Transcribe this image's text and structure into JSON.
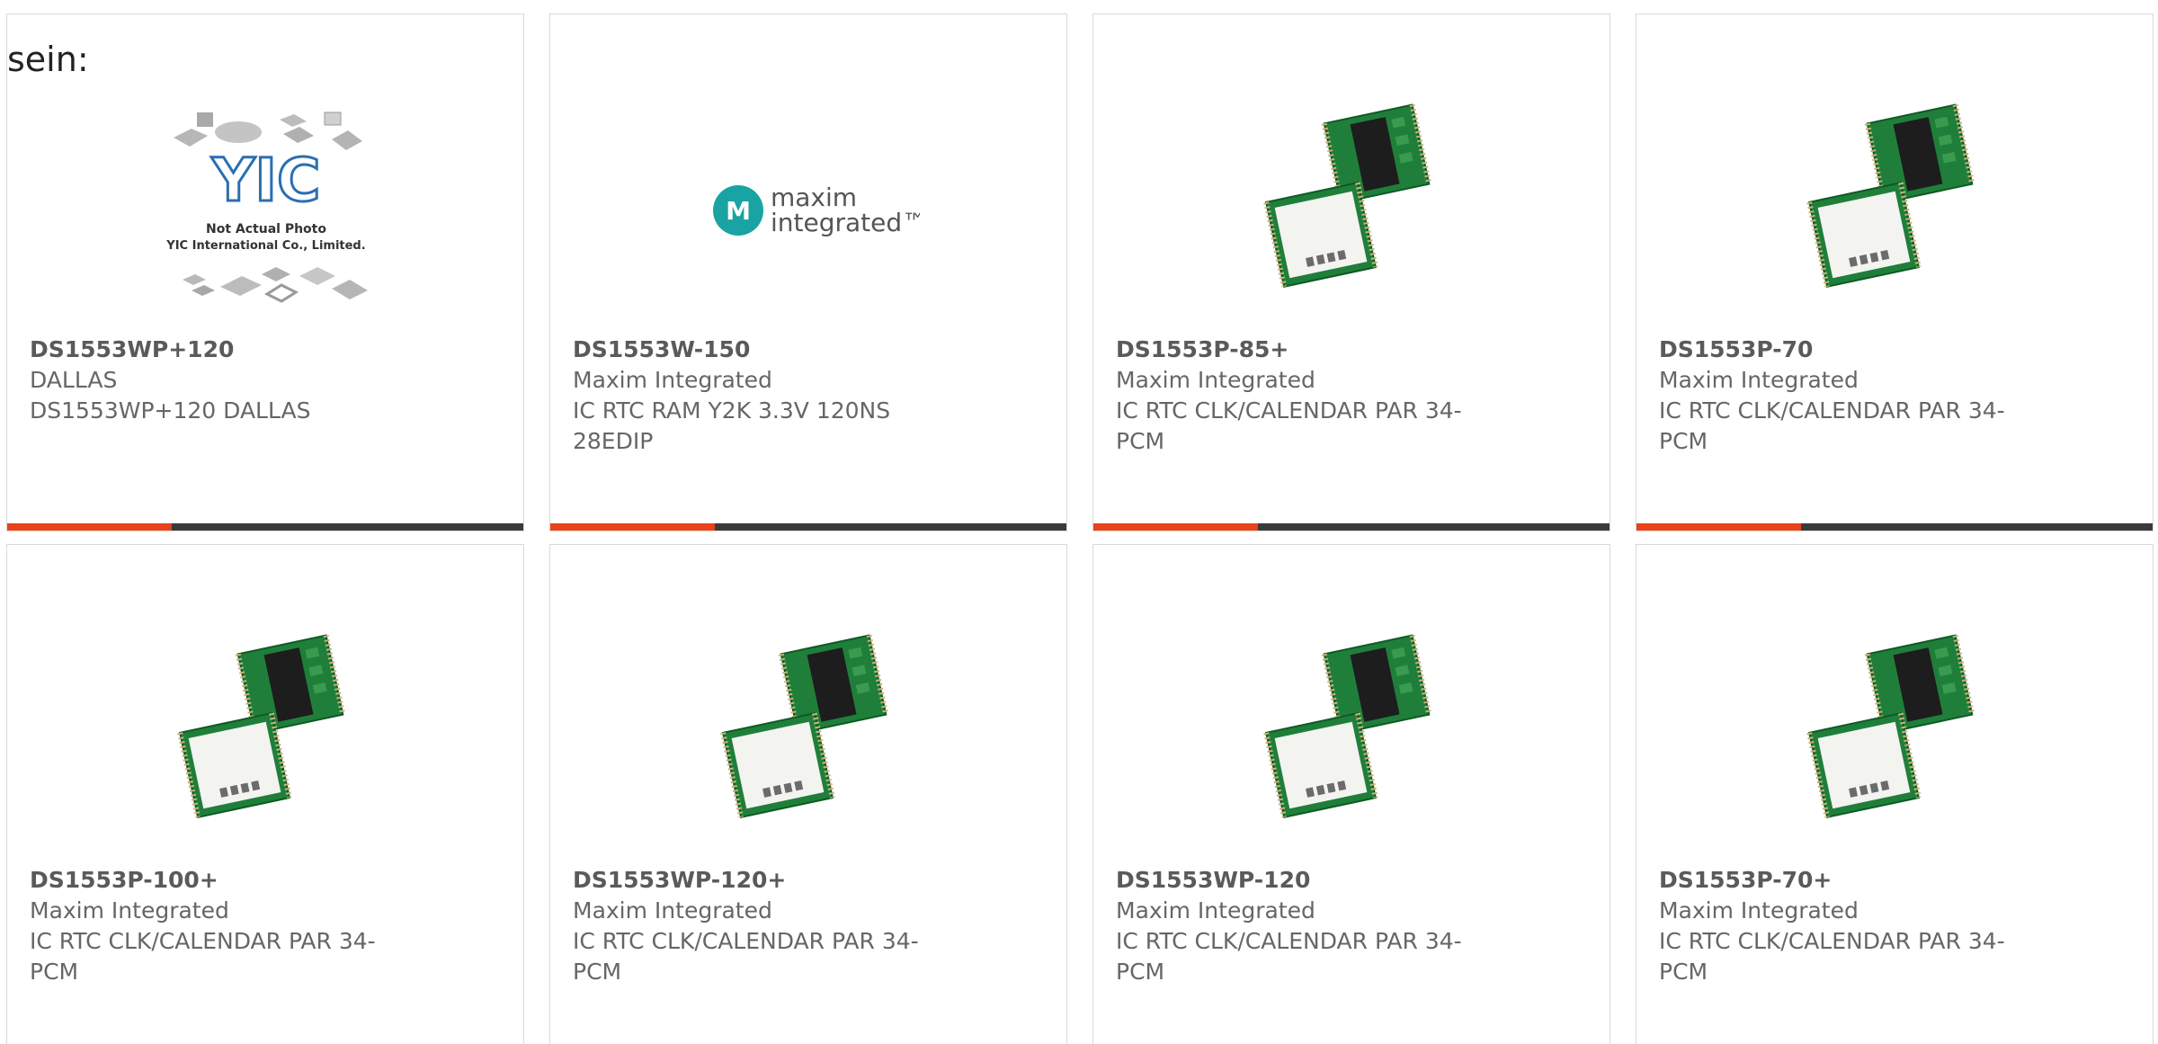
{
  "intro_text": "sein:",
  "colors": {
    "accent": "#e8421a",
    "bar": "#3a3a3a",
    "text": "#666666",
    "border": "#d9d9d9",
    "maxim_teal": "#1aa3a3"
  },
  "products": [
    {
      "part_number": "DS1553WP+120",
      "manufacturer": "DALLAS",
      "description": "DS1553WP+120 DALLAS",
      "image": "not-actual-photo-placeholder",
      "image_text_line1": "Not Actual Photo",
      "image_text_line2": "YIC International Co., Limited.",
      "image_logo": "YIC"
    },
    {
      "part_number": "DS1553W-150",
      "manufacturer": "Maxim Integrated",
      "description": "IC RTC RAM Y2K 3.3V 120NS 28EDIP",
      "image": "maxim-integrated-logo",
      "logo_text_line1": "maxim",
      "logo_text_line2": "integrated™"
    },
    {
      "part_number": "DS1553P-85+",
      "manufacturer": "Maxim Integrated",
      "description": "IC RTC CLK/CALENDAR PAR 34-PCM",
      "image": "pcm-module-photo"
    },
    {
      "part_number": "DS1553P-70",
      "manufacturer": "Maxim Integrated",
      "description": "IC RTC CLK/CALENDAR PAR 34-PCM",
      "image": "pcm-module-photo"
    },
    {
      "part_number": "DS1553P-100+",
      "manufacturer": "Maxim Integrated",
      "description": "IC RTC CLK/CALENDAR PAR 34-PCM",
      "image": "pcm-module-photo"
    },
    {
      "part_number": "DS1553WP-120+",
      "manufacturer": "Maxim Integrated",
      "description": "IC RTC CLK/CALENDAR PAR 34-PCM",
      "image": "pcm-module-photo"
    },
    {
      "part_number": "DS1553WP-120",
      "manufacturer": "Maxim Integrated",
      "description": "IC RTC CLK/CALENDAR PAR 34-PCM",
      "image": "pcm-module-photo"
    },
    {
      "part_number": "DS1553P-70+",
      "manufacturer": "Maxim Integrated",
      "description": "IC RTC CLK/CALENDAR PAR 34-PCM",
      "image": "pcm-module-photo"
    }
  ]
}
